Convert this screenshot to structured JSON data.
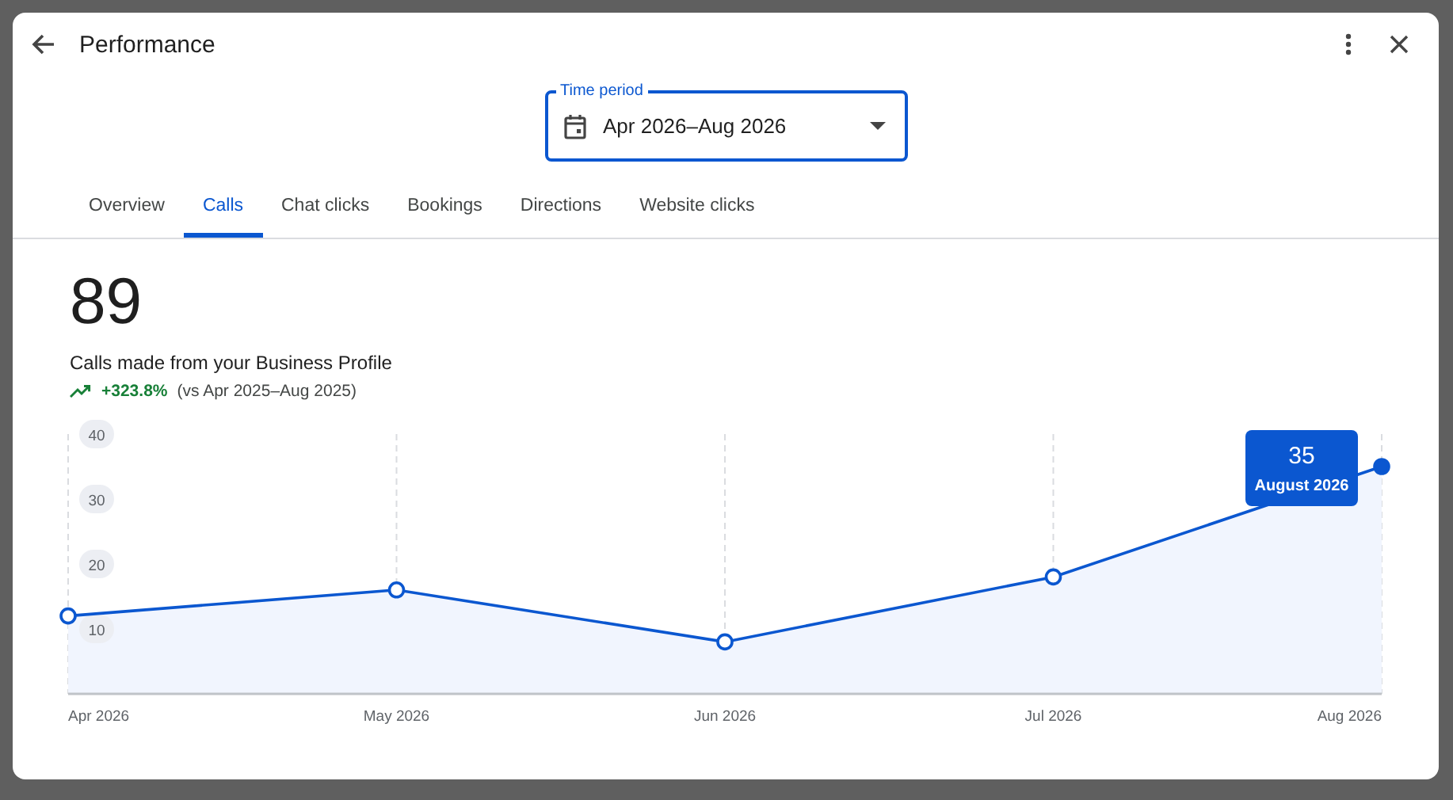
{
  "dialog": {
    "title": "Performance"
  },
  "time_period": {
    "label": "Time period",
    "value": "Apr 2026–Aug 2026"
  },
  "tabs": [
    {
      "label": "Overview",
      "selected": false
    },
    {
      "label": "Calls",
      "selected": true
    },
    {
      "label": "Chat clicks",
      "selected": false
    },
    {
      "label": "Bookings",
      "selected": false
    },
    {
      "label": "Directions",
      "selected": false
    },
    {
      "label": "Website clicks",
      "selected": false
    }
  ],
  "metric": {
    "value": "89",
    "description": "Calls made from your Business Profile",
    "change": "+323.8%",
    "comparison": "(vs Apr 2025–Aug 2025)"
  },
  "chart_data": {
    "type": "area",
    "categories": [
      "Apr 2026",
      "May 2026",
      "Jun 2026",
      "Jul 2026",
      "Aug 2026"
    ],
    "series": [
      {
        "color": "#0b57d0",
        "values": [
          12,
          16,
          8,
          18,
          35
        ]
      }
    ],
    "ylim": [
      0,
      40
    ],
    "yticks": [
      10,
      20,
      30,
      40
    ],
    "grid": true,
    "annotations": [
      {
        "x": "Aug 2026",
        "y": 35,
        "text": "35"
      }
    ]
  },
  "tooltip": {
    "label": "August 2026"
  }
}
